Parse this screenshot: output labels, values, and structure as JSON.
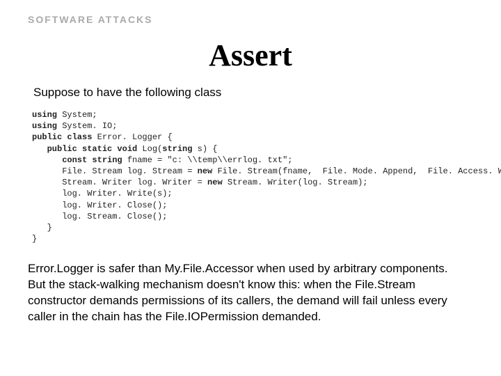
{
  "header": "SOFTWARE ATTACKS",
  "title": "Assert",
  "intro": "Suppose to have the following class",
  "code": {
    "lines": [
      [
        [
          "using",
          true
        ],
        [
          " System;",
          false
        ]
      ],
      [
        [
          "using",
          true
        ],
        [
          " System. IO;",
          false
        ]
      ],
      [
        [
          "public class",
          true
        ],
        [
          " Error. Logger {",
          false
        ]
      ],
      [
        [
          "   public static void",
          true
        ],
        [
          " Log(",
          false
        ],
        [
          "string",
          true
        ],
        [
          " s) {",
          false
        ]
      ],
      [
        [
          "      const string",
          true
        ],
        [
          " fname = \"c: \\\\temp\\\\errlog. txt\";",
          false
        ]
      ],
      [
        [
          "      File. Stream log. Stream = ",
          false
        ],
        [
          "new",
          true
        ],
        [
          " File. Stream(fname,  File. Mode. Append,  File. Access. Write);",
          false
        ]
      ],
      [
        [
          "      Stream. Writer log. Writer = ",
          false
        ],
        [
          "new",
          true
        ],
        [
          " Stream. Writer(log. Stream);",
          false
        ]
      ],
      [
        [
          "      log. Writer. Write(s);",
          false
        ]
      ],
      [
        [
          "      log. Writer. Close();",
          false
        ]
      ],
      [
        [
          "      log. Stream. Close();",
          false
        ]
      ],
      [
        [
          "   }",
          false
        ]
      ],
      [
        [
          "}",
          false
        ]
      ]
    ]
  },
  "outro_lines": [
    "Error.Logger is safer than My.File.Accessor when used by arbitrary components.",
    "But the stack-walking mechanism doesn't know this: when the File.Stream constructor demands permissions of its callers, the demand will fail unless every caller in the chain has the File.IOPermission demanded."
  ]
}
